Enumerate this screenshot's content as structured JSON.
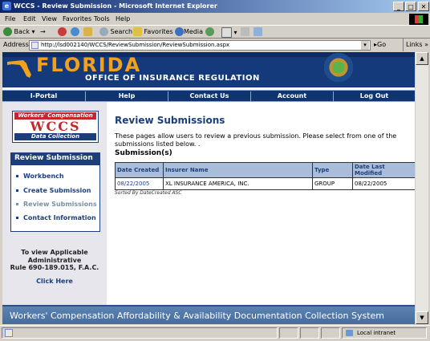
{
  "window": {
    "title": "WCCS - Review Submission - Microsoft Internet Explorer",
    "min": "_",
    "max": "□",
    "close": "✕"
  },
  "menu": [
    "File",
    "Edit",
    "View",
    "Favorites",
    "Tools",
    "Help"
  ],
  "toolbar": {
    "back": "Back",
    "forward": "→",
    "search": "Search",
    "favorites": "Favorites",
    "media": "Media"
  },
  "address": {
    "label": "Address",
    "url": "http://lsd002140/WCCS/ReviewSubmission/ReviewSubmission.aspx",
    "go": "Go",
    "links": "Links"
  },
  "banner": {
    "state": "FLORIDA",
    "office": "OFFICE OF INSURANCE REGULATION"
  },
  "nav": [
    "I-Portal",
    "Help",
    "Contact Us",
    "Account",
    "Log Out"
  ],
  "logo": {
    "top": "Workers' Compensation",
    "mid": "WCCS",
    "bottom": "Data Collection"
  },
  "sidebar": {
    "heading": "Review Submission",
    "items": [
      {
        "label": "Workbench",
        "current": false
      },
      {
        "label": "Create Submission",
        "current": false
      },
      {
        "label": "Review Submissions",
        "current": true
      },
      {
        "label": "Contact Information",
        "current": false
      }
    ],
    "note1": "To view Applicable",
    "note2": "Administrative",
    "note3": "Rule 690-189.015, F.A.C.",
    "click": "Click Here"
  },
  "main": {
    "title": "Review Submissions",
    "description": "These pages allow users to review a previous submission. Please select from one of the submissions listed below. .",
    "subheading": "Submission(s)",
    "columns": [
      "Date Created",
      "Insurer Name",
      "Type",
      "Date Last Modified"
    ],
    "rows": [
      [
        "08/22/2005",
        "XL INSURANCE AMERICA, INC.",
        "GROUP",
        "08/22/2005"
      ]
    ],
    "sorted": "Sorted By DateCreated ASC"
  },
  "footer": "Workers' Compensation Affordability & Availability Documentation Collection System",
  "status": {
    "zone": "Local intranet"
  }
}
